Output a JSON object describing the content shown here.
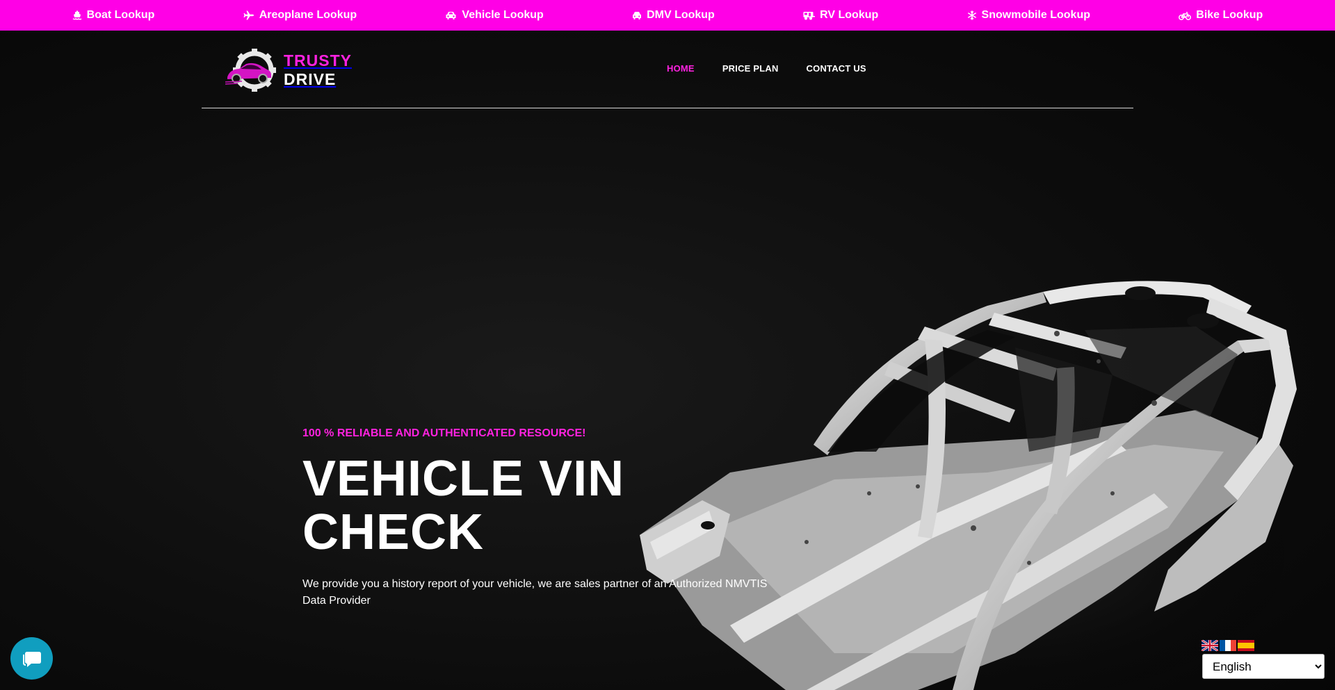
{
  "topbar": {
    "links": [
      {
        "label": "Boat Lookup",
        "icon": "ship-icon"
      },
      {
        "label": "Areoplane Lookup",
        "icon": "plane-icon"
      },
      {
        "label": "Vehicle Lookup",
        "icon": "car-icon"
      },
      {
        "label": "DMV Lookup",
        "icon": "car-icon"
      },
      {
        "label": "RV Lookup",
        "icon": "rv-icon"
      },
      {
        "label": "Snowmobile Lookup",
        "icon": "snowflake-icon"
      },
      {
        "label": "Bike Lookup",
        "icon": "bicycle-icon"
      }
    ]
  },
  "header": {
    "logo": {
      "line1": "TRUSTY",
      "line2": "DRIVE"
    },
    "nav": [
      {
        "label": "HOME",
        "active": true
      },
      {
        "label": "PRICE PLAN",
        "active": false
      },
      {
        "label": "CONTACT US",
        "active": false
      }
    ]
  },
  "hero": {
    "eyebrow": "100 % RELIABLE AND AUTHENTICATED RESOURCE!",
    "title_line1": "VEHICLE VIN",
    "title_line2": "CHECK",
    "description": "We provide you a history report of your vehicle, we are sales partner of an Authorized NMVTIS Data Provider"
  },
  "language": {
    "flags": [
      "uk-flag",
      "france-flag",
      "spain-flag"
    ],
    "selected": "English"
  },
  "colors": {
    "accent": "#ff00e6",
    "accent_text": "#ff22e0",
    "chat": "#109ebf"
  }
}
